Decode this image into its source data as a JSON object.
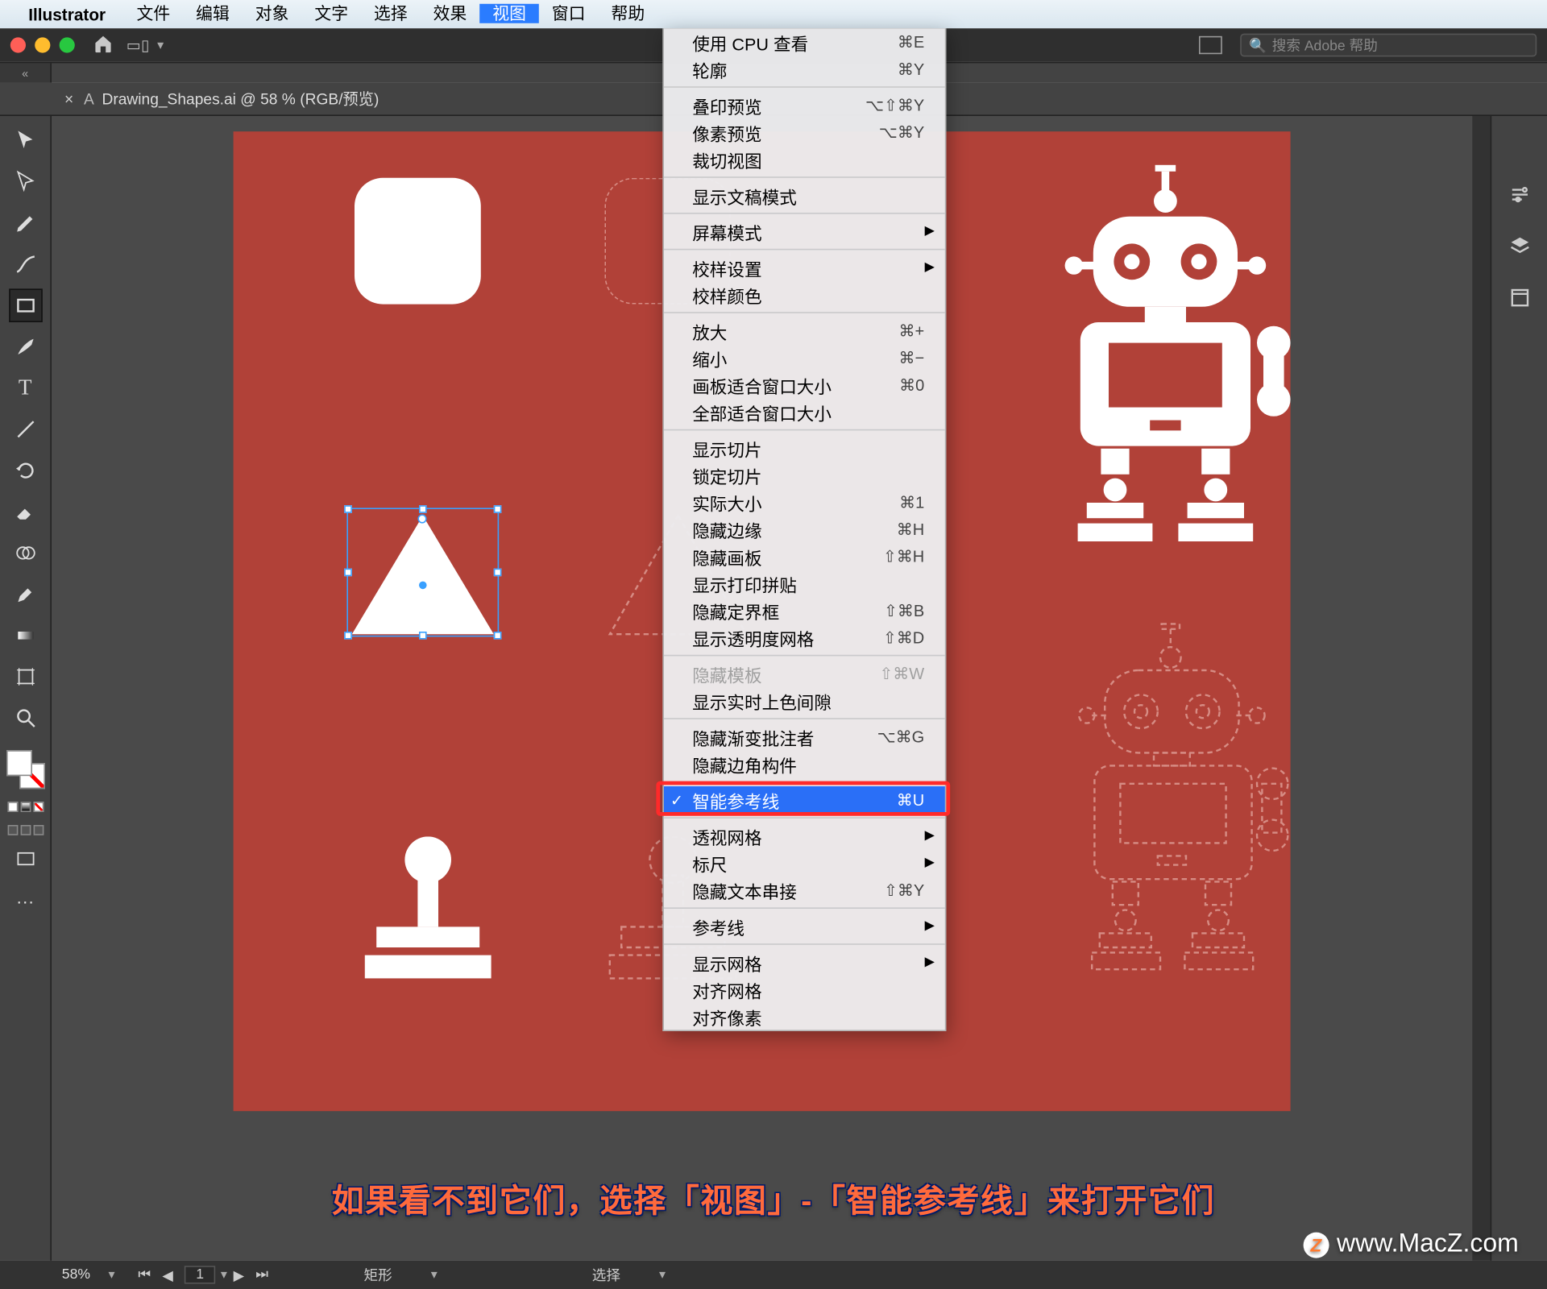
{
  "mac_menu": {
    "app_name": "Illustrator",
    "items": [
      "文件",
      "编辑",
      "对象",
      "文字",
      "选择",
      "效果",
      "视图",
      "窗口",
      "帮助"
    ],
    "active_index": 6
  },
  "search": {
    "placeholder": "搜索 Adobe 帮助"
  },
  "document_tab": {
    "title": "Drawing_Shapes.ai @ 58 % (RGB/预览)",
    "prefix": "A"
  },
  "dropdown": {
    "items": [
      {
        "label": "使用 CPU 查看",
        "shortcut": "⌘E"
      },
      {
        "label": "轮廓",
        "shortcut": "⌘Y"
      },
      {
        "sep": true
      },
      {
        "label": "叠印预览",
        "shortcut": "⌥⇧⌘Y"
      },
      {
        "label": "像素预览",
        "shortcut": "⌥⌘Y"
      },
      {
        "label": "裁切视图"
      },
      {
        "sep": true
      },
      {
        "label": "显示文稿模式"
      },
      {
        "sep": true
      },
      {
        "label": "屏幕模式",
        "submenu": true
      },
      {
        "sep": true
      },
      {
        "label": "校样设置",
        "submenu": true
      },
      {
        "label": "校样颜色"
      },
      {
        "sep": true
      },
      {
        "label": "放大",
        "shortcut": "⌘+"
      },
      {
        "label": "缩小",
        "shortcut": "⌘−"
      },
      {
        "label": "画板适合窗口大小",
        "shortcut": "⌘0"
      },
      {
        "label": "全部适合窗口大小"
      },
      {
        "sep": true
      },
      {
        "label": "显示切片"
      },
      {
        "label": "锁定切片"
      },
      {
        "label": "实际大小",
        "shortcut": "⌘1"
      },
      {
        "label": "隐藏边缘",
        "shortcut": "⌘H"
      },
      {
        "label": "隐藏画板",
        "shortcut": "⇧⌘H"
      },
      {
        "label": "显示打印拼贴"
      },
      {
        "label": "隐藏定界框",
        "shortcut": "⇧⌘B"
      },
      {
        "label": "显示透明度网格",
        "shortcut": "⇧⌘D"
      },
      {
        "sep": true
      },
      {
        "label": "隐藏模板",
        "shortcut": "⇧⌘W",
        "disabled": true
      },
      {
        "label": "显示实时上色间隙"
      },
      {
        "sep": true
      },
      {
        "label": "隐藏渐变批注者",
        "shortcut": "⌥⌘G"
      },
      {
        "label": "隐藏边角构件"
      },
      {
        "sep": true
      },
      {
        "label": "智能参考线",
        "shortcut": "⌘U",
        "checked": true,
        "selected": true,
        "highlight": true
      },
      {
        "sep": true
      },
      {
        "label": "透视网格",
        "submenu": true
      },
      {
        "label": "标尺",
        "submenu": true
      },
      {
        "label": "隐藏文本串接",
        "shortcut": "⇧⌘Y"
      },
      {
        "sep": true
      },
      {
        "label": "参考线",
        "submenu": true
      },
      {
        "sep": true
      },
      {
        "label": "显示网格",
        "submenu": true
      },
      {
        "label": "对齐网格"
      },
      {
        "label": "对齐像素"
      }
    ]
  },
  "status_bar": {
    "zoom": "58%",
    "artboard": "1",
    "tool_label": "矩形",
    "context_label": "选择"
  },
  "caption": "如果看不到它们，选择「视图」-「智能参考线」来打开它们",
  "watermark": "www.MacZ.com"
}
